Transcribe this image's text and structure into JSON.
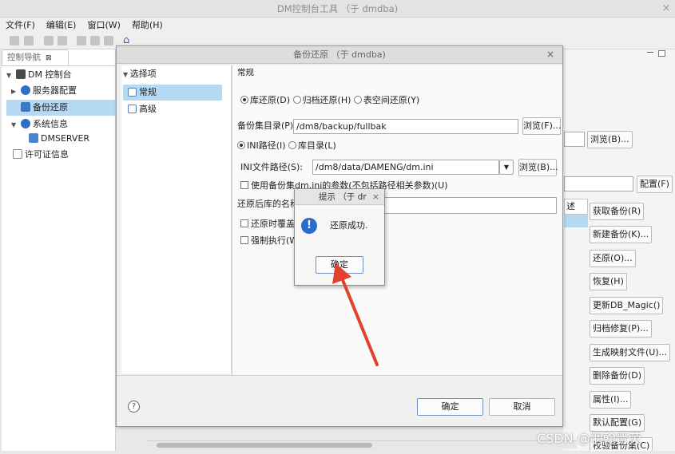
{
  "app": {
    "title": "DM控制台工具 （于 dmdba)"
  },
  "menu": [
    "文件(F)",
    "编辑(E)",
    "窗口(W)",
    "帮助(H)"
  ],
  "nav": {
    "tab_label": "控制导航",
    "tab_close": "⊠",
    "items": [
      {
        "label": "DM 控制台",
        "toggle": "▼",
        "icon_color": "#4a4a4a"
      },
      {
        "label": "服务器配置",
        "toggle": "▶",
        "icon_color": "#2d6fc2"
      },
      {
        "label": "备份还原",
        "toggle": "",
        "icon_color": "#3a78c8"
      },
      {
        "label": "系统信息",
        "toggle": "▼",
        "icon_color": "#2d6fc2"
      },
      {
        "label": "DMSERVER",
        "toggle": "",
        "icon_color": "#4a86c8"
      },
      {
        "label": "许可证信息",
        "toggle": "",
        "icon_color": "#888888"
      }
    ]
  },
  "background": {
    "browse_label": "浏览(B)...",
    "config_label": "配置(F)",
    "col_header": "述",
    "buttons": [
      "获取备份(R)",
      "新建备份(K)...",
      "还原(O)...",
      "恢复(H)",
      "更新DB_Magic()",
      "归档修复(P)...",
      "生成映射文件(U)...",
      "删除备份(D)",
      "属性(I)...",
      "默认配置(G)",
      "校验备份集(C)"
    ]
  },
  "dialog": {
    "title": "备份还原 （于 dmdba)",
    "close": "×",
    "options_header": "选择项",
    "options": [
      "常规",
      "高级"
    ],
    "section_title": "常规",
    "restore_types": [
      "库还原(D)",
      "归档还原(H)",
      "表空间还原(Y)"
    ],
    "backup_dir_label": "备份集目录(P):",
    "backup_dir_value": "/dm8/backup/fullbak",
    "browse_f": "浏览(F)...",
    "path_types": [
      "INI路径(I)",
      "库目录(L)"
    ],
    "ini_label": "INI文件路径(S):",
    "ini_value": "/dm8/data/DAMENG/dm.ini",
    "browse_b": "浏览(B)...",
    "chk_use_ini": "使用备份集dm.ini的参数(不包括路径相关参数)(U)",
    "rename_label": "还原后库的名称",
    "chk_overwrite": "还原时覆盖已",
    "chk_force": "强制执行(W",
    "help": "?",
    "ok": "确定",
    "cancel": "取消"
  },
  "prompt": {
    "title": "提示   （于 dr",
    "close": "×",
    "icon": "!",
    "message": "还原成功.",
    "ok": "确定"
  },
  "watermark": "CSDN @羽翰晋荧",
  "colors": {
    "selection": "#b5d8f3",
    "arrow": "#e2412b",
    "info": "#2a6ccd"
  }
}
